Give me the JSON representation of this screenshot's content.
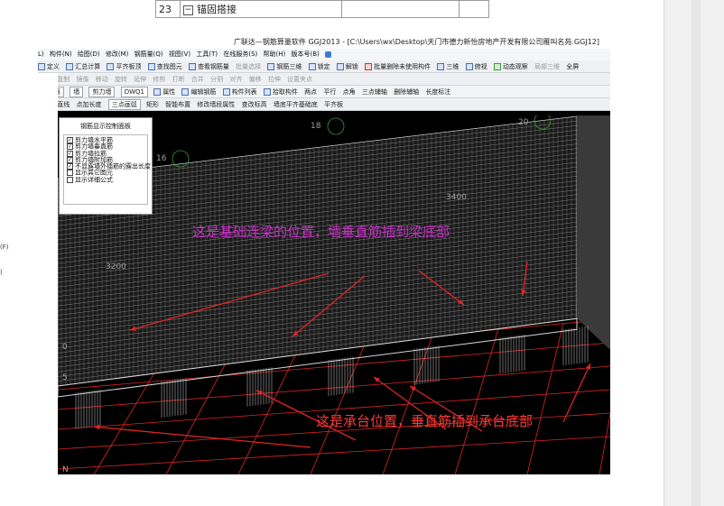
{
  "document": {
    "table_row": {
      "number": "23",
      "expander": "−",
      "label": "锚固搭接"
    },
    "left_edge_fragments": [
      "(F)",
      ")"
    ]
  },
  "app": {
    "title": "广联达—钢筋算量软件 GGJ2013 - [C:\\Users\\wx\\Desktop\\天门市德力新怡房地产开发有限公司雁叫名苑.GGJ12]",
    "menu": [
      "L)",
      "构件(N)",
      "绘图(D)",
      "修改(M)",
      "钢筋量(Q)",
      "视图(V)",
      "工具(T)",
      "在线服务(S)",
      "帮助(H)",
      "版本号(B)"
    ],
    "toolbar1": [
      "定义",
      "汇总计算",
      "平齐板顶",
      "查找图元",
      "查看钢筋量",
      "批量选择",
      "钢筋三维",
      "锁定",
      "解锁",
      "批量删除未使用构件",
      "三维",
      "俯视",
      "动态观察",
      "局部三维",
      "全屏"
    ],
    "toolbar2": [
      "删除",
      "复制",
      "镜像",
      "移动",
      "旋转",
      "延伸",
      "修剪",
      "打断",
      "合并",
      "分割",
      "对齐",
      "偏移",
      "拉伸",
      "设置夹点"
    ],
    "toolbar3": {
      "floor": "第-1层",
      "category": "墙",
      "type": "剪力墙",
      "code": "DWQ1",
      "items": [
        "属性",
        "编辑钢筋",
        "构件列表",
        "拾取构件",
        "两点",
        "平行",
        "点角",
        "三点辅轴",
        "删除辅轴",
        "长度标注"
      ]
    },
    "toolbar4": [
      "选择",
      "直线",
      "点加长度",
      "三点画弧",
      "矩形",
      "智能布置",
      "修改墙段属性",
      "查改标高",
      "墙底平齐基础底",
      "平齐板"
    ],
    "panel": {
      "title": "钢筋显示控制面板",
      "rows": [
        {
          "label": "剪力墙水平筋",
          "checked": true
        },
        {
          "label": "剪力墙垂直筋",
          "checked": true
        },
        {
          "label": "剪力墙拉筋",
          "checked": true
        },
        {
          "label": "剪力墙附加筋",
          "checked": true
        },
        {
          "label": "不显露墙外插筋的露出长度",
          "checked": true
        },
        {
          "label": "显示其它图元",
          "checked": false
        },
        {
          "label": "显示详细公式",
          "checked": false
        }
      ]
    },
    "cad_labels": [
      "18",
      "16",
      "20",
      "3400",
      "3200",
      "0",
      "5",
      "N"
    ],
    "annotations": {
      "purple": "这是基础连梁的位置，墙垂直筋插到梁底部",
      "red": "这是承台位置，垂直筋插到承台底部"
    },
    "colors": {
      "purple": "#c832c8",
      "red": "#ff3a3a",
      "rebar": "#d8d8d8",
      "grid": "#e02424"
    }
  }
}
